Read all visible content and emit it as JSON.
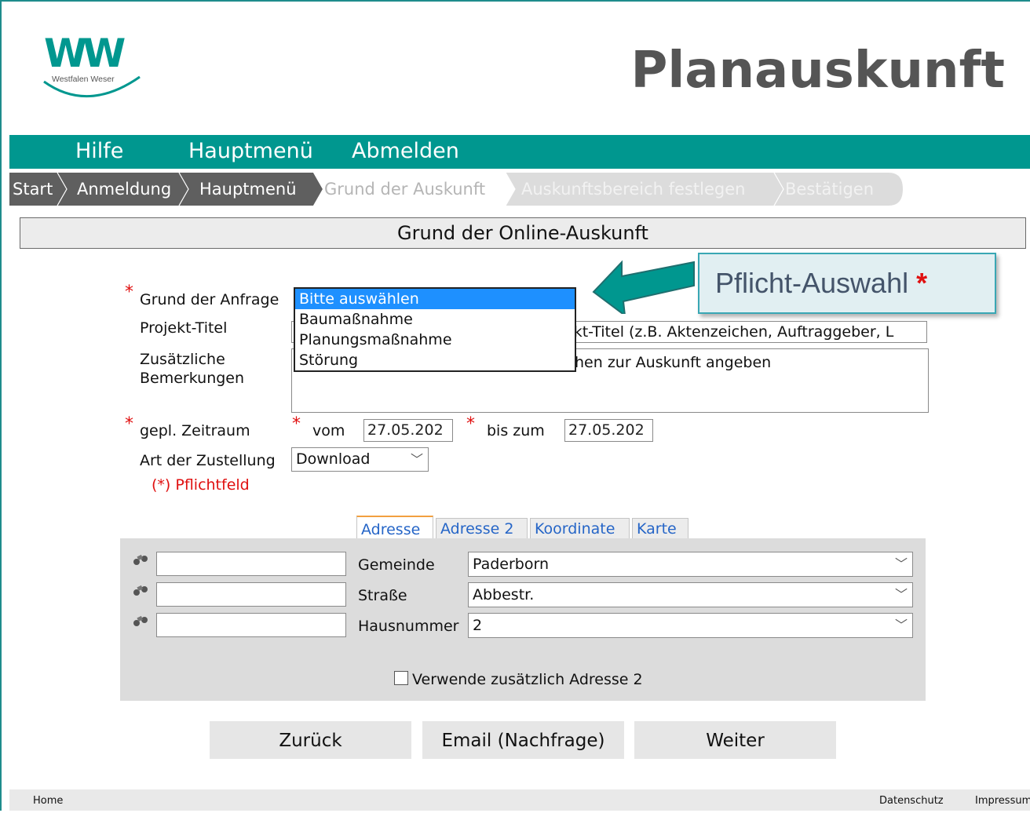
{
  "header": {
    "logo_text": "WW",
    "logo_subtitle": "Westfalen Weser",
    "app_title": "Planauskunft"
  },
  "nav": {
    "items": [
      {
        "label": "Hilfe"
      },
      {
        "label": "Hauptmenü"
      },
      {
        "label": "Abmelden"
      }
    ]
  },
  "breadcrumb": {
    "steps": [
      {
        "label": "Start",
        "state": "done"
      },
      {
        "label": "Anmeldung",
        "state": "done"
      },
      {
        "label": "Hauptmenü",
        "state": "done"
      },
      {
        "label": "Grund der Auskunft",
        "state": "current"
      },
      {
        "label": "Auskunftsbereich festlegen",
        "state": "todo"
      },
      {
        "label": "Bestätigen",
        "state": "todo"
      }
    ]
  },
  "section_title": "Grund der Online-Auskunft",
  "form": {
    "required_marker": "*",
    "grund_label": "Grund der Anfrage",
    "grund_options": [
      "Bitte auswählen",
      "Baumaßnahme",
      "Planungsmaßnahme",
      "Störung"
    ],
    "grund_selected_index": 0,
    "projekt_label": "Projekt-Titel",
    "projekt_placeholder": "ekt-Titel (z.B. Aktenzeichen, Auftraggeber, L",
    "bemerkungen_label_1": "Zusätzliche",
    "bemerkungen_label_2": "Bemerkungen",
    "bemerkungen_placeholder": "hen zur Auskunft angeben",
    "zeitraum_label": "gepl. Zeitraum",
    "vom_label": "vom",
    "vom_value": "27.05.202",
    "bis_label": "bis zum",
    "bis_value": "27.05.202",
    "zustellung_label": "Art der Zustellung",
    "zustellung_value": "Download",
    "pflichtfeld_note": "(*) Pflichtfeld"
  },
  "callout": {
    "text": "Pflicht-Auswahl",
    "star": "*",
    "color": "#39a7b4"
  },
  "tabs": [
    {
      "label": "Adresse",
      "active": true
    },
    {
      "label": "Adresse 2",
      "active": false
    },
    {
      "label": "Koordinate",
      "active": false
    },
    {
      "label": "Karte",
      "active": false
    }
  ],
  "address": {
    "gemeinde_label": "Gemeinde",
    "gemeinde_value": "Paderborn",
    "strasse_label": "Straße",
    "strasse_value": "Abbestr.",
    "hausnummer_label": "Hausnummer",
    "hausnummer_value": "2",
    "checkbox_label": "Verwende zusätzlich Adresse 2",
    "checkbox_checked": false,
    "search_icon": "binoculars-icon"
  },
  "buttons": {
    "back": "Zurück",
    "email": "Email (Nachfrage)",
    "next": "Weiter"
  },
  "footer": {
    "home": "Home",
    "privacy": "Datenschutz",
    "imprint": "Impressum"
  },
  "colors": {
    "brand": "#00978f",
    "required": "#e01010",
    "link": "#2565c7"
  }
}
